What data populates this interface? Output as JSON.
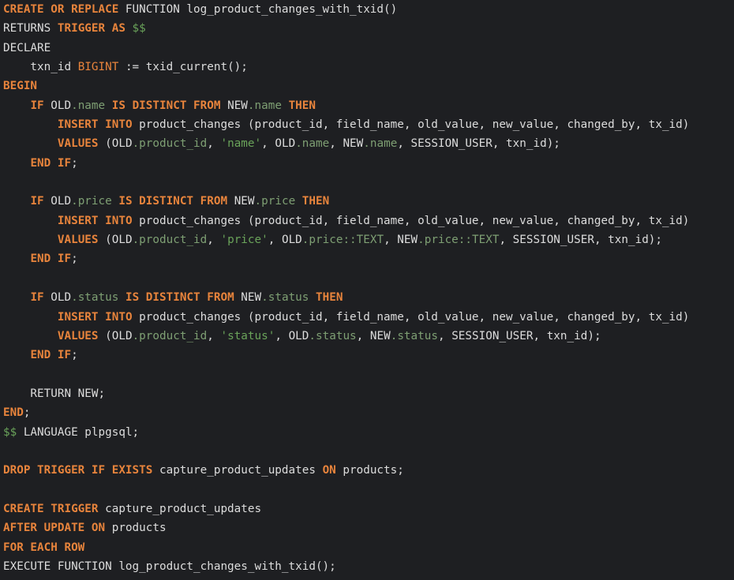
{
  "colors": {
    "background": "#1e1f22",
    "keyword": "#e8843c",
    "identifier": "#dcdcdc",
    "field": "#7e9f73",
    "string": "#6aa35a"
  },
  "code": {
    "lines": [
      [
        [
          "kw",
          "CREATE OR REPLACE"
        ],
        [
          "id",
          " FUNCTION log_product_changes_with_txid()"
        ]
      ],
      [
        [
          "id",
          "RETURNS "
        ],
        [
          "kw",
          "TRIGGER AS"
        ],
        [
          "ds",
          " $$"
        ]
      ],
      [
        [
          "id",
          "DECLARE"
        ]
      ],
      [
        [
          "id",
          "    txn_id "
        ],
        [
          "ty",
          "BIGINT"
        ],
        [
          "id",
          " := txid_current();"
        ]
      ],
      [
        [
          "kw",
          "BEGIN"
        ]
      ],
      [
        [
          "id",
          "    "
        ],
        [
          "kw",
          "IF"
        ],
        [
          "id",
          " OLD"
        ],
        [
          "fd",
          ".name"
        ],
        [
          "id",
          " "
        ],
        [
          "kw",
          "IS DISTINCT FROM"
        ],
        [
          "id",
          " NEW"
        ],
        [
          "fd",
          ".name"
        ],
        [
          "id",
          " "
        ],
        [
          "kw",
          "THEN"
        ]
      ],
      [
        [
          "id",
          "        "
        ],
        [
          "kw",
          "INSERT INTO"
        ],
        [
          "id",
          " product_changes (product_id, field_name, old_value, new_value, changed_by, tx_id)"
        ]
      ],
      [
        [
          "id",
          "        "
        ],
        [
          "kw",
          "VALUES"
        ],
        [
          "id",
          " (OLD"
        ],
        [
          "fd",
          ".product_id"
        ],
        [
          "id",
          ", "
        ],
        [
          "st",
          "'name'"
        ],
        [
          "id",
          ", OLD"
        ],
        [
          "fd",
          ".name"
        ],
        [
          "id",
          ", NEW"
        ],
        [
          "fd",
          ".name"
        ],
        [
          "id",
          ", SESSION_USER, txn_id);"
        ]
      ],
      [
        [
          "id",
          "    "
        ],
        [
          "kw",
          "END IF"
        ],
        [
          "id",
          ";"
        ]
      ],
      [],
      [
        [
          "id",
          "    "
        ],
        [
          "kw",
          "IF"
        ],
        [
          "id",
          " OLD"
        ],
        [
          "fd",
          ".price"
        ],
        [
          "id",
          " "
        ],
        [
          "kw",
          "IS DISTINCT FROM"
        ],
        [
          "id",
          " NEW"
        ],
        [
          "fd",
          ".price"
        ],
        [
          "id",
          " "
        ],
        [
          "kw",
          "THEN"
        ]
      ],
      [
        [
          "id",
          "        "
        ],
        [
          "kw",
          "INSERT INTO"
        ],
        [
          "id",
          " product_changes (product_id, field_name, old_value, new_value, changed_by, tx_id)"
        ]
      ],
      [
        [
          "id",
          "        "
        ],
        [
          "kw",
          "VALUES"
        ],
        [
          "id",
          " (OLD"
        ],
        [
          "fd",
          ".product_id"
        ],
        [
          "id",
          ", "
        ],
        [
          "st",
          "'price'"
        ],
        [
          "id",
          ", OLD"
        ],
        [
          "fd",
          ".price::TEXT"
        ],
        [
          "id",
          ", NEW"
        ],
        [
          "fd",
          ".price::TEXT"
        ],
        [
          "id",
          ", SESSION_USER, txn_id);"
        ]
      ],
      [
        [
          "id",
          "    "
        ],
        [
          "kw",
          "END IF"
        ],
        [
          "id",
          ";"
        ]
      ],
      [],
      [
        [
          "id",
          "    "
        ],
        [
          "kw",
          "IF"
        ],
        [
          "id",
          " OLD"
        ],
        [
          "fd",
          ".status"
        ],
        [
          "id",
          " "
        ],
        [
          "kw",
          "IS DISTINCT FROM"
        ],
        [
          "id",
          " NEW"
        ],
        [
          "fd",
          ".status"
        ],
        [
          "id",
          " "
        ],
        [
          "kw",
          "THEN"
        ]
      ],
      [
        [
          "id",
          "        "
        ],
        [
          "kw",
          "INSERT INTO"
        ],
        [
          "id",
          " product_changes (product_id, field_name, old_value, new_value, changed_by, tx_id)"
        ]
      ],
      [
        [
          "id",
          "        "
        ],
        [
          "kw",
          "VALUES"
        ],
        [
          "id",
          " (OLD"
        ],
        [
          "fd",
          ".product_id"
        ],
        [
          "id",
          ", "
        ],
        [
          "st",
          "'status'"
        ],
        [
          "id",
          ", OLD"
        ],
        [
          "fd",
          ".status"
        ],
        [
          "id",
          ", NEW"
        ],
        [
          "fd",
          ".status"
        ],
        [
          "id",
          ", SESSION_USER, txn_id);"
        ]
      ],
      [
        [
          "id",
          "    "
        ],
        [
          "kw",
          "END IF"
        ],
        [
          "id",
          ";"
        ]
      ],
      [],
      [
        [
          "id",
          "    RETURN NEW;"
        ]
      ],
      [
        [
          "kw",
          "END"
        ],
        [
          "id",
          ";"
        ]
      ],
      [
        [
          "ds",
          "$$"
        ],
        [
          "id",
          " LANGUAGE plpgsql;"
        ]
      ],
      [],
      [
        [
          "kw",
          "DROP TRIGGER IF EXISTS"
        ],
        [
          "id",
          " capture_product_updates "
        ],
        [
          "kw",
          "ON"
        ],
        [
          "id",
          " products;"
        ]
      ],
      [],
      [
        [
          "kw",
          "CREATE TRIGGER"
        ],
        [
          "id",
          " capture_product_updates"
        ]
      ],
      [
        [
          "kw",
          "AFTER UPDATE ON"
        ],
        [
          "id",
          " products"
        ]
      ],
      [
        [
          "kw",
          "FOR EACH ROW"
        ]
      ],
      [
        [
          "id",
          "EXECUTE FUNCTION log_product_changes_with_txid();"
        ]
      ]
    ]
  }
}
